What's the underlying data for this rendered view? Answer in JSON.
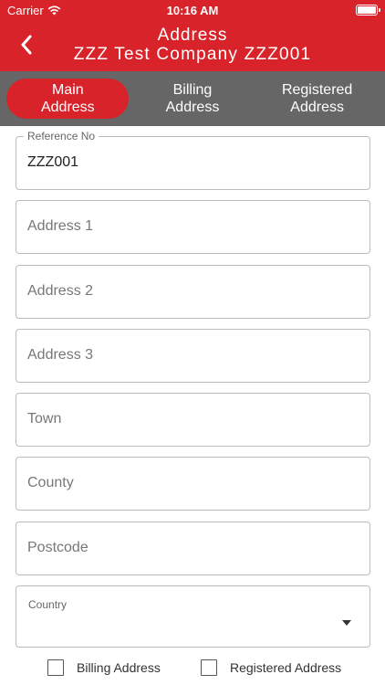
{
  "status_bar": {
    "carrier": "Carrier",
    "time": "10:16 AM",
    "wifi_icon": "wifi-icon",
    "battery_icon": "battery-icon"
  },
  "nav": {
    "title": "Address",
    "subtitle": "ZZZ Test Company ZZZ001",
    "back_icon": "chevron-left-icon"
  },
  "tabs": [
    {
      "label_line1": "Main",
      "label_line2": "Address",
      "active": true
    },
    {
      "label_line1": "Billing",
      "label_line2": "Address",
      "active": false
    },
    {
      "label_line1": "Registered",
      "label_line2": "Address",
      "active": false
    }
  ],
  "form": {
    "reference": {
      "label": "Reference No",
      "value": "ZZZ001"
    },
    "address1": {
      "placeholder": "Address 1"
    },
    "address2": {
      "placeholder": "Address 2"
    },
    "address3": {
      "placeholder": "Address 3"
    },
    "town": {
      "placeholder": "Town"
    },
    "county": {
      "placeholder": "County"
    },
    "postcode": {
      "placeholder": "Postcode"
    },
    "country": {
      "label": "Country",
      "value": ""
    }
  },
  "checks": {
    "billing": {
      "label": "Billing Address",
      "checked": false
    },
    "registered": {
      "label": "Registered Address",
      "checked": false
    }
  },
  "colors": {
    "brand_red": "#d8232a",
    "tab_bar_grey": "#666666",
    "border_grey": "#bdbdbd"
  }
}
